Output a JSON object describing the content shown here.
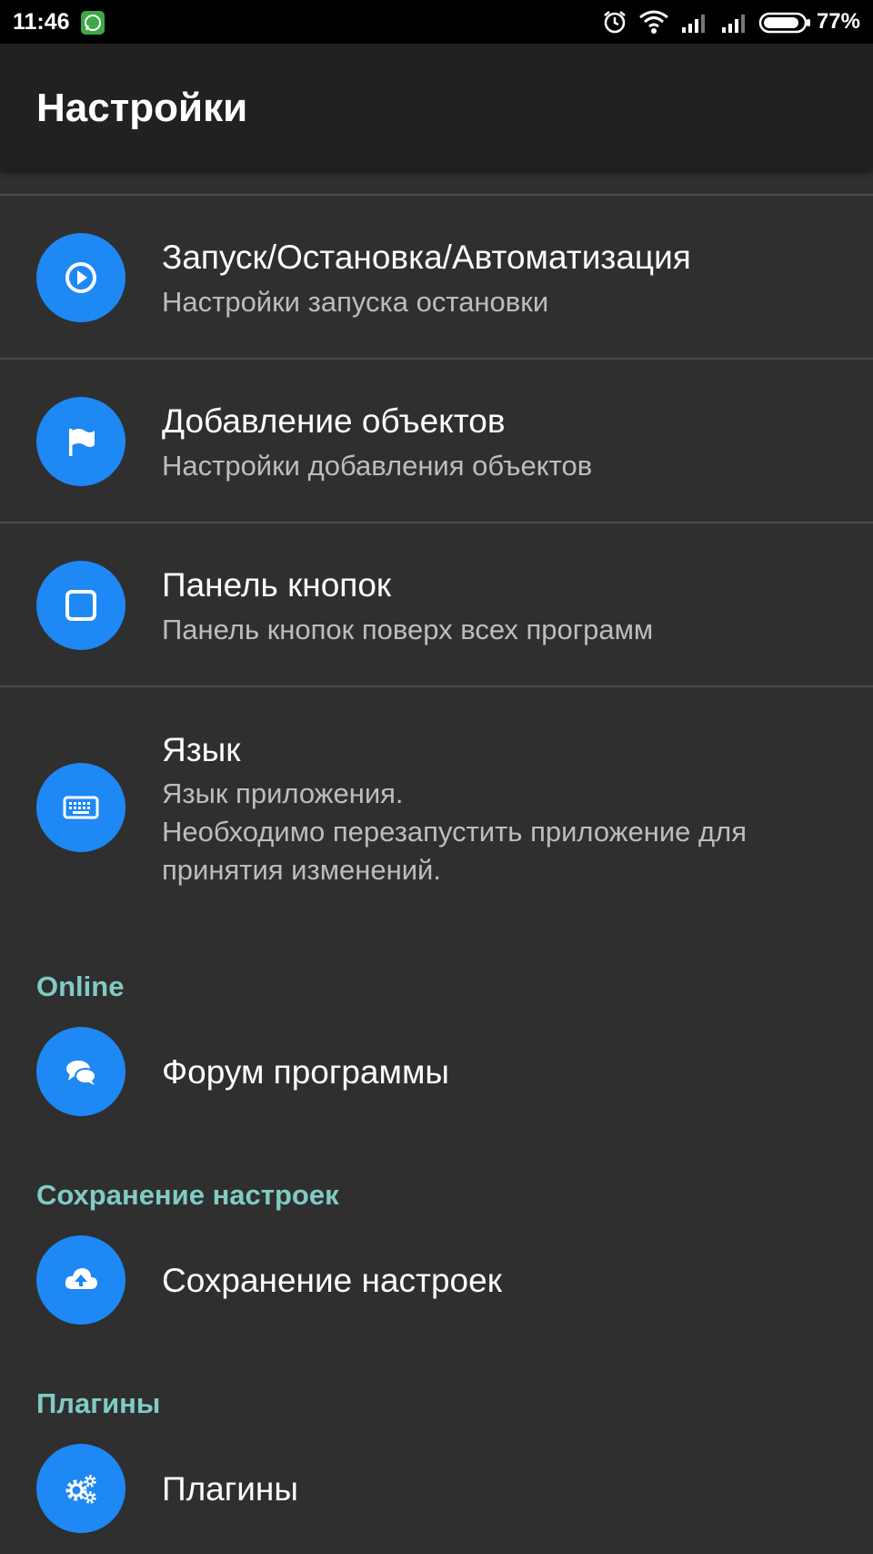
{
  "status_bar": {
    "time": "11:46",
    "battery": "77%",
    "icons": [
      "whatsapp-icon",
      "alarm-icon",
      "wifi-icon",
      "signal-icon",
      "signal-icon",
      "battery-icon"
    ]
  },
  "app_bar": {
    "title": "Настройки"
  },
  "items": [
    {
      "title": "Запуск/Остановка/Автоматизация",
      "summary": "Настройки запуска остановки",
      "icon": "play-circle-icon"
    },
    {
      "title": "Добавление объектов",
      "summary": "Настройки добавления объектов",
      "icon": "flag-icon"
    },
    {
      "title": "Панель кнопок",
      "summary": "Панель кнопок поверх всех программ",
      "icon": "square-icon"
    },
    {
      "title": "Язык",
      "summary_lines": [
        "Язык приложения.",
        "Необходимо перезапустить приложение для",
        "принятия изменений."
      ],
      "icon": "keyboard-icon"
    }
  ],
  "sections": [
    {
      "header": "Online",
      "item": {
        "title": "Форум программы",
        "icon": "forum-icon"
      }
    },
    {
      "header": "Сохранение настроек",
      "item": {
        "title": "Сохранение настроек",
        "icon": "cloud-upload-icon"
      }
    },
    {
      "header": "Плагины",
      "item": {
        "title": "Плагины",
        "icon": "gears-icon"
      }
    }
  ],
  "colors": {
    "background": "#2f2f2f",
    "app_bar": "#212121",
    "accent_icon": "#1e88f5",
    "section_header": "#80cbc4",
    "summary_text": "#bdbdbd"
  }
}
